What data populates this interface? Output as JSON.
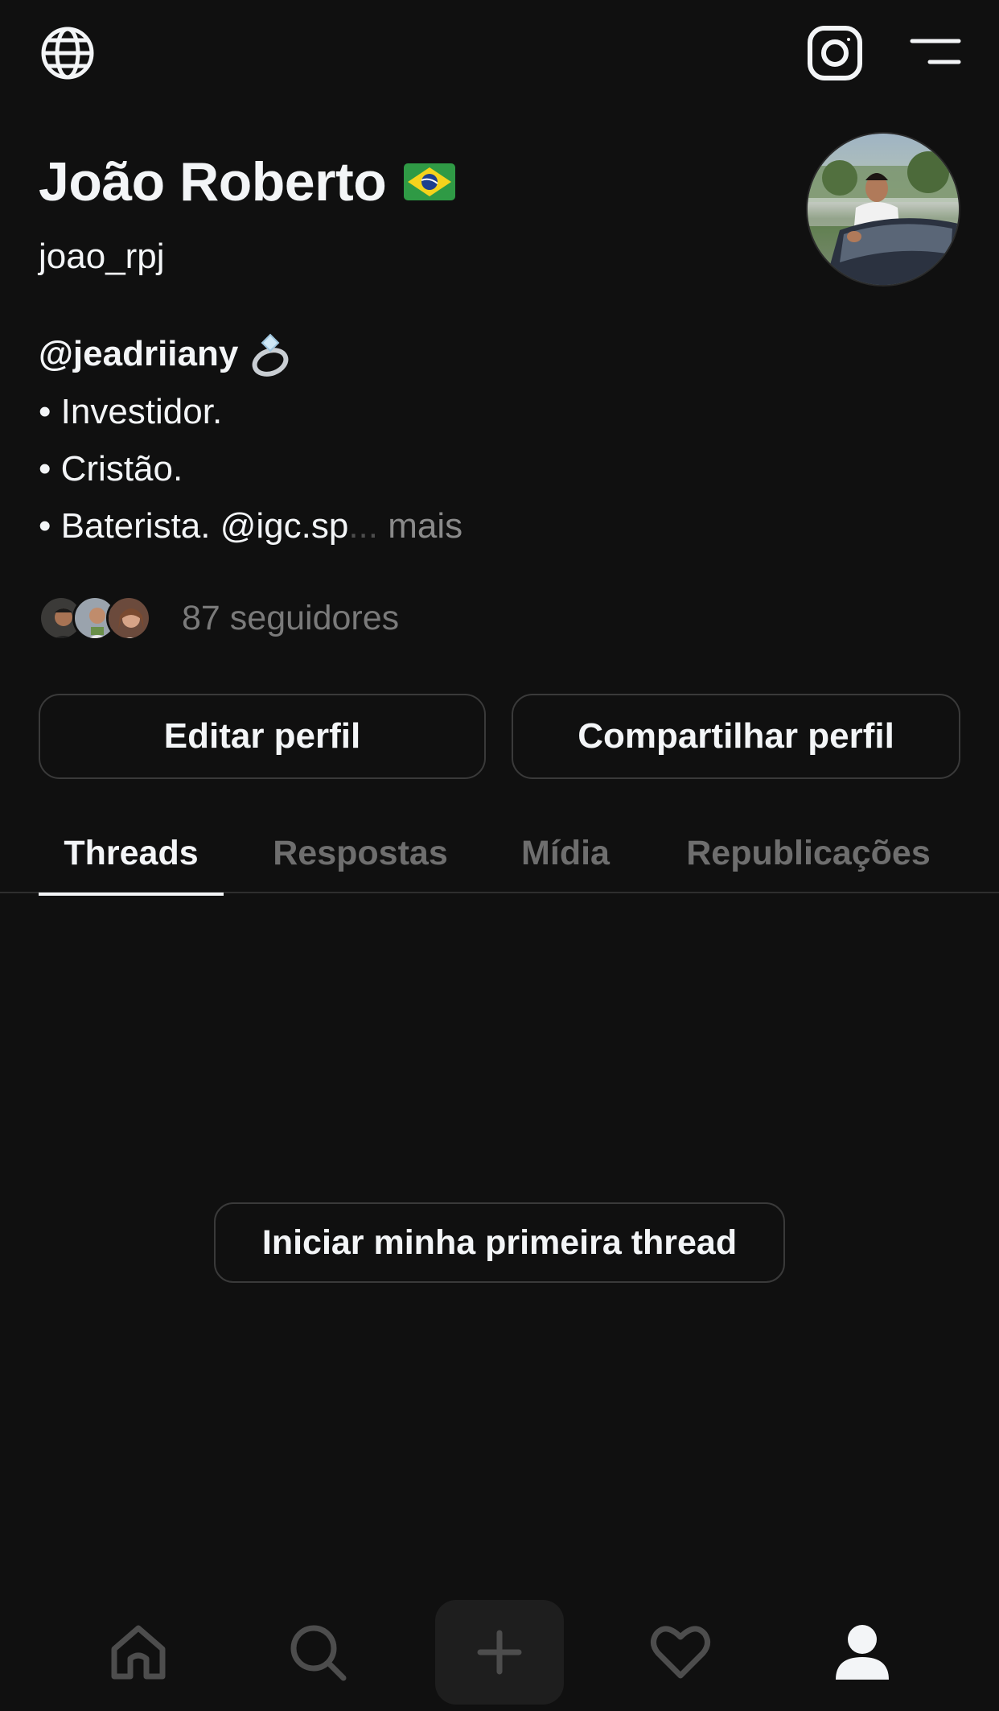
{
  "profile": {
    "name": "João Roberto",
    "username": "joao_rpj",
    "bio": {
      "line1": "@jeadriiany",
      "line2": "• Investidor.",
      "line3": "• Cristão.",
      "line4_text": "• Baterista. @igc.sp",
      "line4_ellipsis": "...",
      "more": "mais"
    },
    "followers": "87 seguidores"
  },
  "buttons": {
    "edit": "Editar perfil",
    "share": "Compartilhar perfil"
  },
  "tabs": [
    {
      "label": "Threads",
      "active": true
    },
    {
      "label": "Respostas",
      "active": false
    },
    {
      "label": "Mídia",
      "active": false
    },
    {
      "label": "Republicações",
      "active": false
    }
  ],
  "empty_state": {
    "cta": "Iniciar minha primeira thread"
  },
  "icons": {
    "top_left": "globe-icon",
    "top_right_1": "instagram-icon",
    "top_right_2": "menu-icon",
    "flag": "brazil-flag-icon",
    "ring": "ring-emoji-icon",
    "nav": [
      "home-icon",
      "search-icon",
      "plus-icon",
      "heart-icon",
      "profile-icon"
    ]
  },
  "colors": {
    "background": "#101010",
    "text": "#f3f5f7",
    "muted": "#7a7a7a",
    "border": "#3a3a3a"
  }
}
